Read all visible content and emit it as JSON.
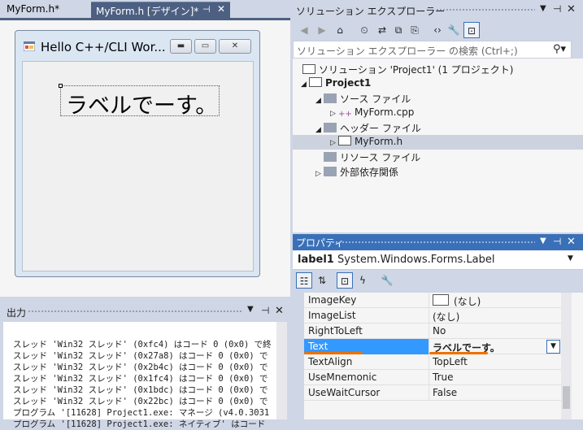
{
  "designer": {
    "tabs": [
      {
        "label": "MyForm.h*"
      },
      {
        "label": "MyForm.h [デザイン]*"
      }
    ],
    "form_title": "Hello C++/CLI Wor...",
    "label_text": "ラベルでーす。"
  },
  "output": {
    "title": "出力",
    "lines": [
      "スレッド 'Win32 スレッド' (0xfc4) はコード 0 (0x0) で終",
      "スレッド 'Win32 スレッド' (0x27a8) はコード 0 (0x0) で",
      "スレッド 'Win32 スレッド' (0x2b4c) はコード 0 (0x0) で",
      "スレッド 'Win32 スレッド' (0x1fc4) はコード 0 (0x0) で",
      "スレッド 'Win32 スレッド' (0x1bdc) はコード 0 (0x0) で",
      "スレッド 'Win32 スレッド' (0x22bc) はコード 0 (0x0) で",
      "プログラム '[11628] Project1.exe: マネージ (v4.0.3031",
      "プログラム '[11628] Project1.exe: ネイティブ' はコード"
    ]
  },
  "solution_explorer": {
    "title": "ソリューション エクスプローラー",
    "search_placeholder": "ソリューション エクスプローラー の検索 (Ctrl+;)",
    "tree": [
      {
        "label": "ソリューション 'Project1' (1 プロジェクト)",
        "level": 0,
        "arrow": ""
      },
      {
        "label": "Project1",
        "level": 0,
        "arrow": "◢"
      },
      {
        "label": "ソース ファイル",
        "level": 1,
        "arrow": "◢"
      },
      {
        "label": "MyForm.cpp",
        "level": 2,
        "arrow": "▷"
      },
      {
        "label": "ヘッダー ファイル",
        "level": 1,
        "arrow": "◢"
      },
      {
        "label": "MyForm.h",
        "level": 2,
        "arrow": "▷"
      },
      {
        "label": "リソース ファイル",
        "level": 1,
        "arrow": ""
      },
      {
        "label": "外部依存関係",
        "level": 1,
        "arrow": "▷"
      }
    ],
    "selected": "MyForm.h"
  },
  "properties": {
    "title": "プロパティ",
    "object_name": "label1",
    "object_type": "System.Windows.Forms.Label",
    "rows": [
      {
        "key": "ImageKey",
        "value": "(なし)"
      },
      {
        "key": "ImageList",
        "value": "(なし)"
      },
      {
        "key": "RightToLeft",
        "value": "No"
      },
      {
        "key": "Text",
        "value": "ラベルでーす。"
      },
      {
        "key": "TextAlign",
        "value": "TopLeft"
      },
      {
        "key": "UseMnemonic",
        "value": "True"
      },
      {
        "key": "UseWaitCursor",
        "value": "False"
      }
    ],
    "selected_row": "Text"
  },
  "colors": {
    "accent": "#3399ff",
    "highlight_underline": "#f07000",
    "header_active": "#3a70b8"
  }
}
